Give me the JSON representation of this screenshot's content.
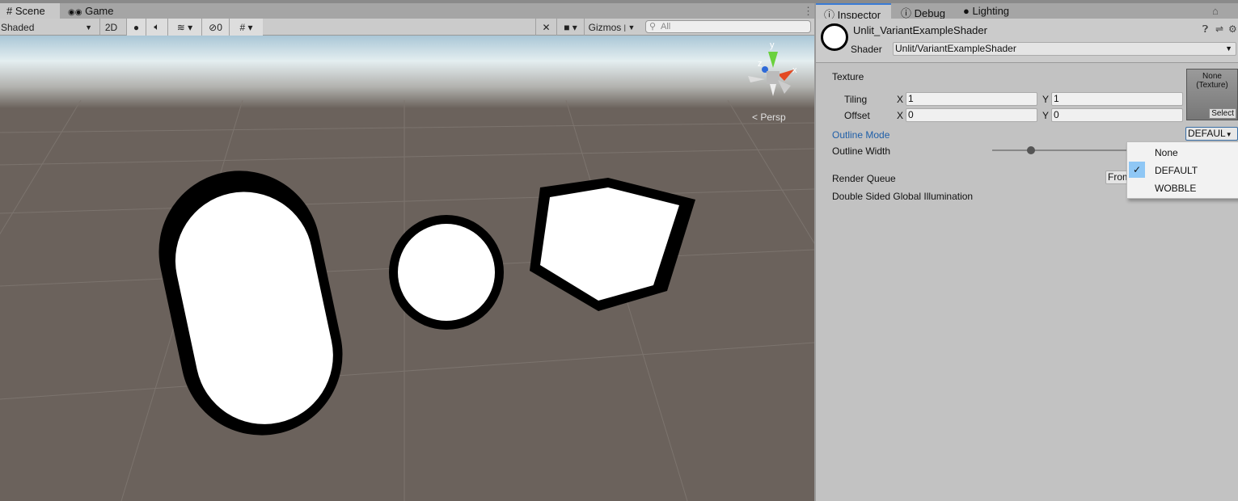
{
  "scene_tabs": [
    {
      "label": "Scene",
      "icon": "grid-icon"
    },
    {
      "label": "Game",
      "icon": "gamepad-icon"
    }
  ],
  "toolbar": {
    "draw_mode": "Shaded",
    "two_d": "2D",
    "hidden_count": "0",
    "gizmos": "Gizmos",
    "search_placeholder": "All"
  },
  "scene": {
    "projection": "Persp",
    "axes": {
      "x": "x",
      "y": "y",
      "z": "z"
    }
  },
  "inspector_tabs": [
    {
      "label": "Inspector"
    },
    {
      "label": "Debug"
    },
    {
      "label": "Lighting"
    }
  ],
  "material": {
    "name": "Unlit_VariantExampleShader",
    "shader_label": "Shader",
    "shader": "Unlit/VariantExampleShader"
  },
  "properties": {
    "texture_label": "Texture",
    "texture_value": "None\n(Texture)",
    "select": "Select",
    "tiling_label": "Tiling",
    "offset_label": "Offset",
    "x": "X",
    "y": "Y",
    "tiling_x": "1",
    "tiling_y": "1",
    "offset_x": "0",
    "offset_y": "0",
    "outline_mode_label": "Outline Mode",
    "outline_mode_value": "DEFAUL",
    "outline_width_label": "Outline Width",
    "outline_width_fraction": 0.28,
    "render_queue_label": "Render Queue",
    "render_queue_value": "From",
    "dsgi_label": "Double Sided Global Illumination"
  },
  "dropdown": {
    "options": [
      "None",
      "DEFAULT",
      "WOBBLE"
    ],
    "selected": "DEFAULT"
  },
  "colors": {
    "accent_label": "#1f5fa8",
    "selected_bg": "#8fc7f5",
    "ground": "#6b625c"
  }
}
